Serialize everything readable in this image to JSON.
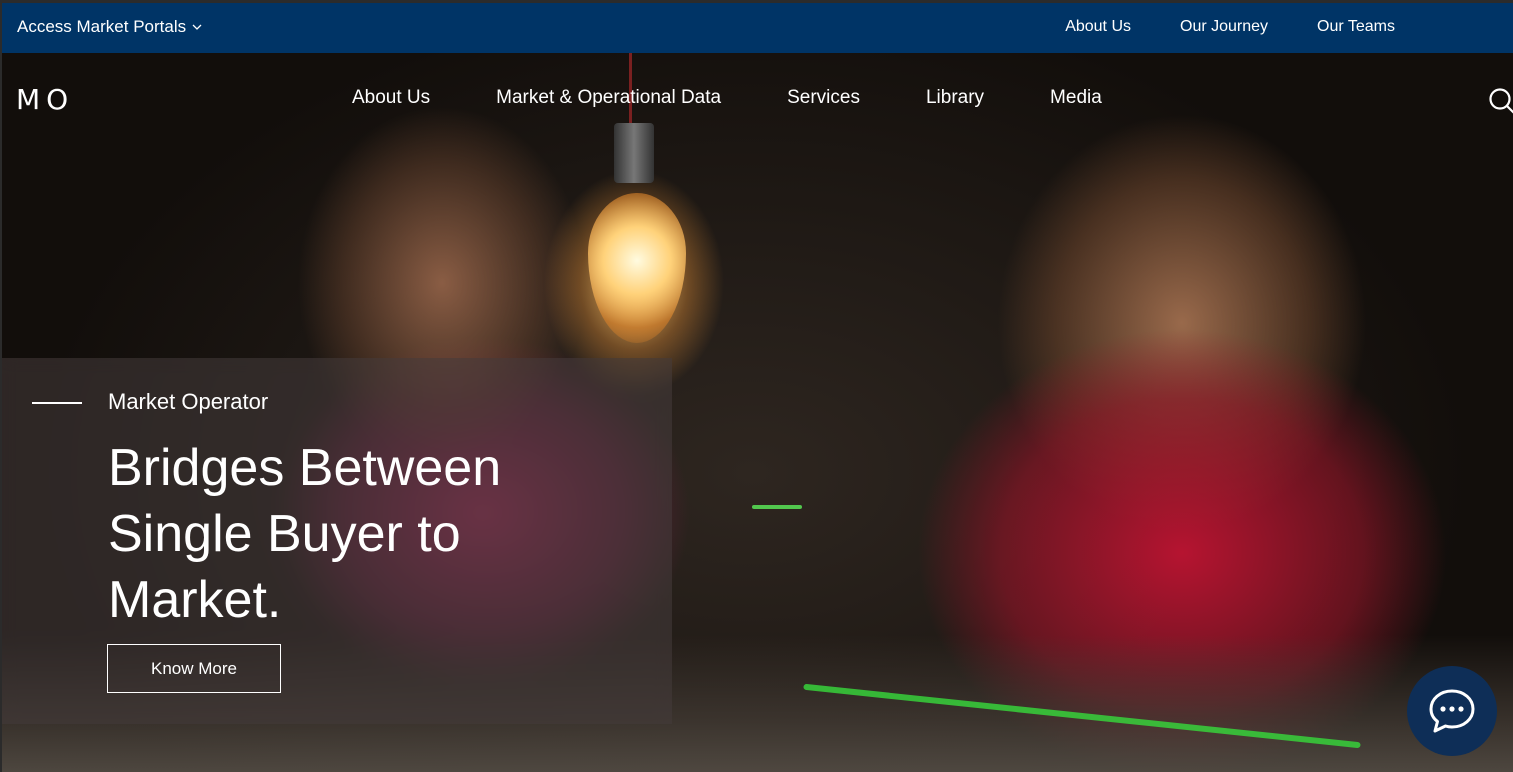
{
  "topbar": {
    "portals_label": "Access Market Portals",
    "links": [
      "About Us",
      "Our Journey",
      "Our Teams"
    ]
  },
  "nav": {
    "logo": "MO",
    "items": [
      "About Us",
      "Market & Operational Data",
      "Services",
      "Library",
      "Media"
    ]
  },
  "hero": {
    "eyebrow": "Market Operator",
    "headline_line1": "Bridges Between",
    "headline_line2": "Single Buyer to",
    "headline_line3": "Market.",
    "cta_label": "Know More"
  },
  "icons": {
    "portals_dropdown": "chevron-down-icon",
    "search": "search-icon",
    "chat": "chat-icon"
  },
  "colors": {
    "topbar_bg": "#003466",
    "chat_bg": "#0e2e57",
    "text": "#ffffff"
  }
}
